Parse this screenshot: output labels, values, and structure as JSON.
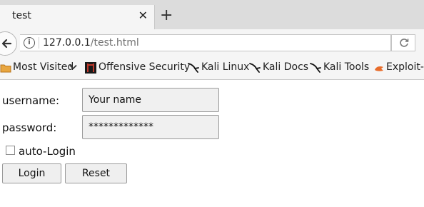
{
  "tab": {
    "title": "test",
    "close_icon": "close-icon"
  },
  "new_tab": {
    "icon": "plus-icon"
  },
  "nav": {
    "back_icon": "back-arrow-icon",
    "info_icon": "info-icon",
    "url_host": "127.0.0.1",
    "url_path": "/test.html",
    "reload_icon": "reload-icon"
  },
  "bookmarks": [
    {
      "label": "Most Visited",
      "icon": "folder-icon"
    },
    {
      "label": "Offensive Security",
      "icon": "offsec-icon"
    },
    {
      "label": "Kali Linux",
      "icon": "kali-dragon-icon"
    },
    {
      "label": "Kali Docs",
      "icon": "kali-dragon-icon"
    },
    {
      "label": "Kali Tools",
      "icon": "kali-dragon-icon"
    },
    {
      "label": "Exploit-D",
      "icon": "exploit-db-icon"
    }
  ],
  "form": {
    "username_label": "username:",
    "username_value": "Your name",
    "password_label": "password:",
    "password_value": "*************",
    "autologin_label": "auto-Login",
    "autologin_checked": false,
    "login_label": "Login",
    "reset_label": "Reset"
  }
}
